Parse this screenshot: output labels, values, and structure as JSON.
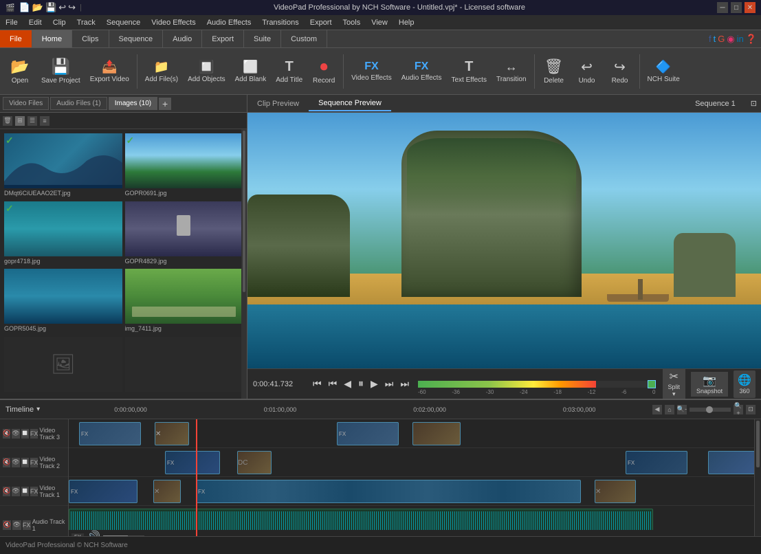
{
  "titlebar": {
    "title": "VideoPad Professional by NCH Software - Untitled.vpj* - Licensed software",
    "icons": [
      "minimize",
      "maximize",
      "close"
    ]
  },
  "menubar": {
    "items": [
      "File",
      "Edit",
      "Clip",
      "Track",
      "Sequence",
      "Video Effects",
      "Audio Effects",
      "Transitions",
      "Export",
      "Tools",
      "View",
      "Help"
    ]
  },
  "tabs": {
    "items": [
      "File",
      "Home",
      "Clips",
      "Sequence",
      "Audio",
      "Export",
      "Suite",
      "Custom"
    ]
  },
  "toolbar": {
    "buttons": [
      {
        "label": "Open",
        "icon": "📂"
      },
      {
        "label": "Save Project",
        "icon": "💾"
      },
      {
        "label": "Export Video",
        "icon": "📤"
      },
      {
        "label": "Add File(s)",
        "icon": "➕"
      },
      {
        "label": "Add Objects",
        "icon": "🔲"
      },
      {
        "label": "Add Blank",
        "icon": "⬜"
      },
      {
        "label": "Add Title",
        "icon": "T"
      },
      {
        "label": "Record",
        "icon": "⏺"
      },
      {
        "label": "Video Effects",
        "icon": "FX"
      },
      {
        "label": "Audio Effects",
        "icon": "FX"
      },
      {
        "label": "Text Effects",
        "icon": "T"
      },
      {
        "label": "Transition",
        "icon": "↔"
      },
      {
        "label": "Delete",
        "icon": "🗑"
      },
      {
        "label": "Undo",
        "icon": "↩"
      },
      {
        "label": "Redo",
        "icon": "↪"
      },
      {
        "label": "NCH Suite",
        "icon": "🔷"
      }
    ]
  },
  "filetabs": {
    "items": [
      "Video Files",
      "Audio Files (1)",
      "Images (10)"
    ]
  },
  "media": {
    "items": [
      {
        "name": "DMqt6CiUEAAO2ET.jpg",
        "color": "#1a4a6a"
      },
      {
        "name": "GOPR0691.jpg",
        "color": "#2a5a3a"
      },
      {
        "name": "gopr4718.jpg",
        "color": "#1a5a4a"
      },
      {
        "name": "GOPR4829.jpg",
        "color": "#3a3a4a"
      },
      {
        "name": "GOPR5045.jpg",
        "color": "#1a4a5a"
      },
      {
        "name": "img_7411.jpg",
        "color": "#2a4a3a"
      },
      {
        "name": "",
        "color": "#3a3a3a"
      },
      {
        "name": "",
        "color": "#3a3a3a"
      }
    ],
    "checked": [
      0,
      1,
      2
    ]
  },
  "preview": {
    "clip_tab": "Clip Preview",
    "sequence_tab": "Sequence Preview",
    "title": "Sequence 1",
    "timecode": "0:00:41.732",
    "snapshot_label": "Snapshot",
    "split_label": "Split",
    "btn360": "360"
  },
  "timeline": {
    "label": "Timeline",
    "timecodes": [
      "0:00:00,000",
      "0:01:00,000",
      "0:02:00,000",
      "0:03:00,000"
    ],
    "tracks": [
      {
        "label": "Video Track 3"
      },
      {
        "label": "Video Track 2"
      },
      {
        "label": "Video Track 1"
      },
      {
        "label": "Audio Track 1"
      }
    ]
  },
  "statusbar": {
    "text": "VideoPad Professional © NCH Software"
  },
  "audio_effects_menu": "Audio Effects",
  "track_menu": "Track"
}
